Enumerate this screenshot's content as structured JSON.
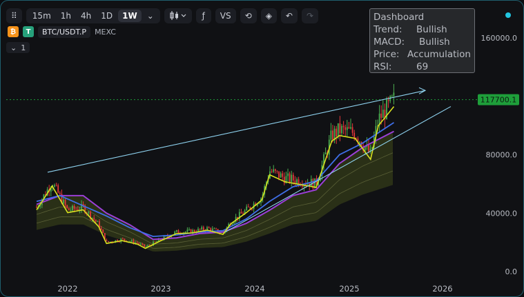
{
  "toolbar": {
    "timeframes": [
      "15m",
      "1h",
      "4h",
      "1D",
      "1W"
    ],
    "active_timeframe": "1W",
    "compare_label": "VS"
  },
  "symbol": {
    "ticker": "BTC/USDT.P",
    "exchange": "MEXC",
    "indicator_count": "1"
  },
  "dashboard": {
    "title": "Dashboard",
    "rows": [
      {
        "key": "Trend:",
        "value": "Bullish"
      },
      {
        "key": "MACD:",
        "value": "Bullish"
      },
      {
        "key": "Price:",
        "value": "Accumulation"
      },
      {
        "key": "RSI:",
        "value": "69"
      }
    ]
  },
  "colors": {
    "up": "#4caf50",
    "down": "#e5373a",
    "price_tag": "#1e9e3a",
    "trendline": "#8fd3f0",
    "accent": "#22c5e0"
  },
  "chart_data": {
    "type": "line",
    "x_tick_labels": [
      "2022",
      "2023",
      "2024",
      "2025",
      "2026"
    ],
    "y_tick_labels": [
      "160000.0",
      "80000.0",
      "40000.0",
      "0.0"
    ],
    "ylim": [
      0,
      170000
    ],
    "current_price_label": "117700.1",
    "current_price": 117700,
    "grid": false,
    "series": [
      {
        "x": [
          "2021-09",
          "2021-11",
          "2022-01",
          "2022-03",
          "2022-05",
          "2022-06",
          "2022-08",
          "2022-10",
          "2022-11",
          "2023-01",
          "2023-03",
          "2023-05",
          "2023-07",
          "2023-09",
          "2023-10",
          "2023-12",
          "2024-02",
          "2024-03",
          "2024-05",
          "2024-07",
          "2024-09",
          "2024-11",
          "2024-12",
          "2025-02",
          "2025-04",
          "2025-05",
          "2025-07"
        ],
        "y": [
          44000,
          61000,
          42000,
          44000,
          32000,
          20000,
          22000,
          19500,
          16500,
          22000,
          27000,
          27500,
          29500,
          26500,
          34000,
          42000,
          51000,
          69000,
          64000,
          62000,
          60000,
          93000,
          97000,
          95000,
          80000,
          104000,
          117700
        ]
      },
      {
        "x": [
          "2021-09",
          "2021-12",
          "2022-03",
          "2022-06",
          "2022-09",
          "2022-12",
          "2023-03",
          "2023-06",
          "2023-09",
          "2023-12",
          "2024-03",
          "2024-06",
          "2024-09",
          "2024-12",
          "2025-03",
          "2025-07"
        ],
        "y": [
          48000,
          52000,
          45000,
          38000,
          30000,
          24000,
          25000,
          27000,
          28000,
          36000,
          48000,
          58000,
          62000,
          80000,
          88000,
          102000
        ]
      },
      {
        "x": [
          "2021-09",
          "2021-12",
          "2022-03",
          "2022-06",
          "2022-09",
          "2022-12",
          "2023-03",
          "2023-06",
          "2023-09",
          "2023-12",
          "2024-03",
          "2024-06",
          "2024-09",
          "2024-12",
          "2025-03",
          "2025-07"
        ],
        "y": [
          46000,
          52000,
          52000,
          40000,
          32000,
          22000,
          23000,
          26000,
          27000,
          33000,
          42000,
          52000,
          56000,
          74000,
          85000,
          96000
        ]
      }
    ]
  }
}
